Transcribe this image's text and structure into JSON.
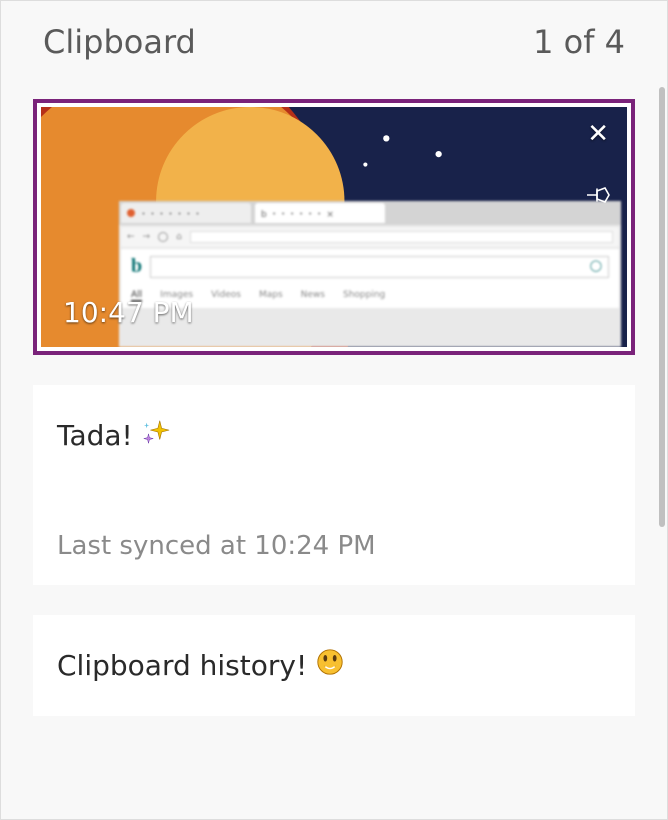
{
  "header": {
    "title": "Clipboard",
    "counter": "1 of 4"
  },
  "items": [
    {
      "type": "image",
      "timestamp": "10:47 PM",
      "close_label": "Delete",
      "pin_label": "Pin"
    },
    {
      "type": "text",
      "text": "Tada!",
      "emoji": "sparkles",
      "sync": "Last synced at 10:24 PM"
    },
    {
      "type": "text",
      "text": "Clipboard history!",
      "emoji": "smiley"
    }
  ],
  "colors": {
    "selection": "#7a237a",
    "background": "#f8f8f8"
  }
}
